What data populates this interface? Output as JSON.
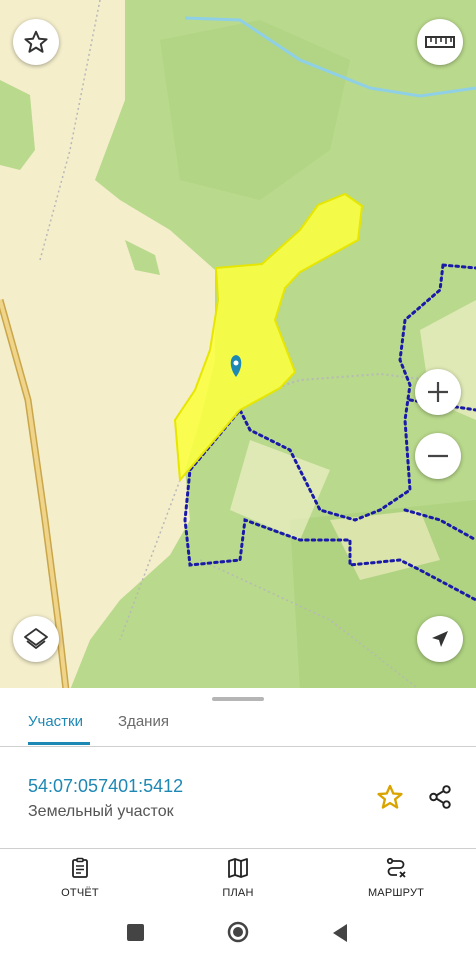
{
  "map": {
    "buttons": {
      "favorite": "star-outline-icon",
      "ruler": "ruler-icon",
      "zoom_in": "plus-icon",
      "zoom_out": "minus-icon",
      "layers": "layers-icon",
      "locate": "navigation-arrow-icon"
    },
    "colors": {
      "forest": "#b9d98c",
      "field": "#f4eecb",
      "parcel_fill": "#fbff3f",
      "parcel_border": "#e6e600",
      "boundary_dots": "#1a1aa8",
      "river": "#8fd0e6",
      "marker": "#1e88b4"
    }
  },
  "tabs": [
    {
      "label": "Участки",
      "active": true
    },
    {
      "label": "Здания",
      "active": false
    }
  ],
  "parcel": {
    "cadastral_number": "54:07:057401:5412",
    "type": "Земельный участок"
  },
  "bottom_nav": [
    {
      "label": "ОТЧЁТ",
      "icon": "clipboard-icon"
    },
    {
      "label": "ПЛАН",
      "icon": "map-icon"
    },
    {
      "label": "МАРШРУТ",
      "icon": "route-icon"
    }
  ],
  "system_nav": [
    "square-icon",
    "circle-icon",
    "back-triangle-icon"
  ],
  "accent_color": "#1e88b4",
  "star_color": "#d9a400"
}
